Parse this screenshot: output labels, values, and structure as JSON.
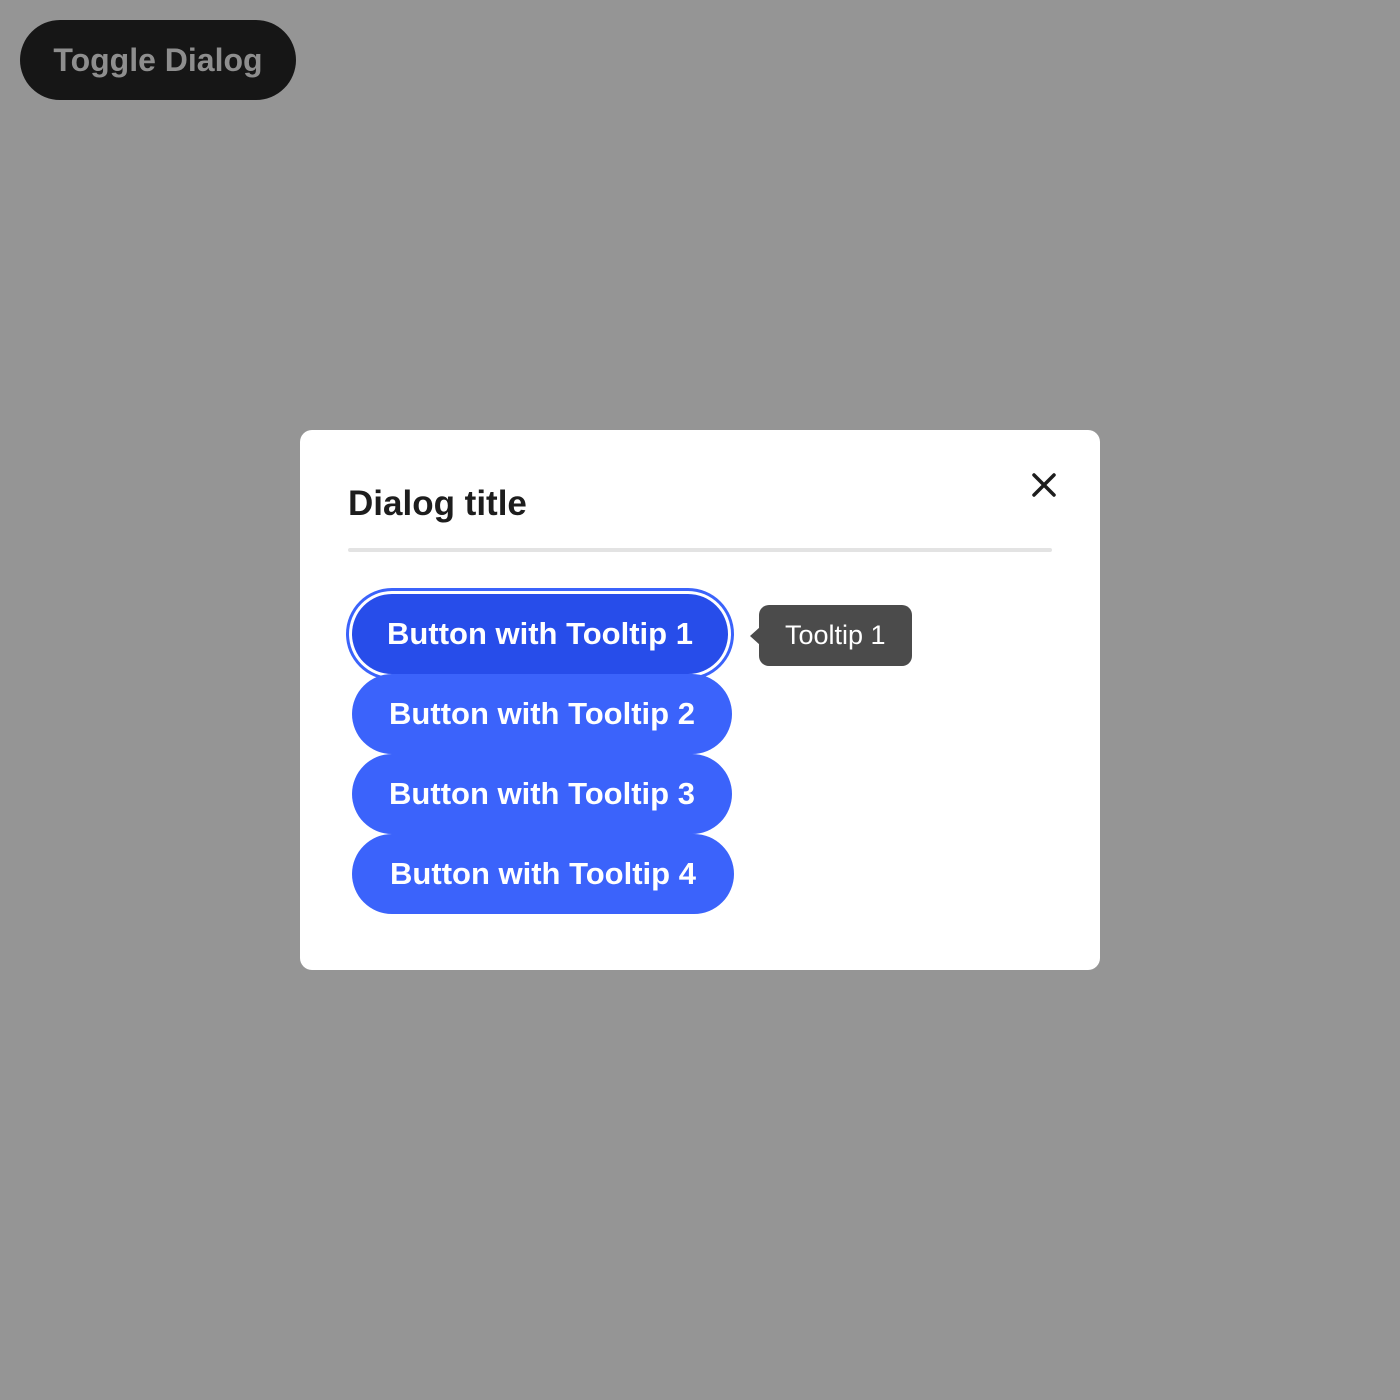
{
  "toggle": {
    "label": "Toggle Dialog"
  },
  "dialog": {
    "title": "Dialog title",
    "close_icon": "close-icon",
    "buttons": [
      {
        "label": "Button with Tooltip 1"
      },
      {
        "label": "Button with Tooltip 2"
      },
      {
        "label": "Button with Tooltip 3"
      },
      {
        "label": "Button with Tooltip 4"
      }
    ],
    "tooltip": {
      "text": "Tooltip 1"
    }
  },
  "colors": {
    "page_background": "#959595",
    "toggle_background": "#161616",
    "accent": "#3b63fb",
    "accent_focused": "#274dea",
    "tooltip_background": "#4b4b4b"
  }
}
